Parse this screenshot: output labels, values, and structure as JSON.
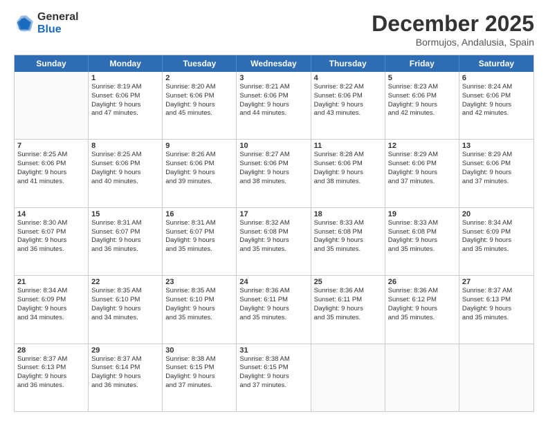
{
  "logo": {
    "general": "General",
    "blue": "Blue"
  },
  "header": {
    "month": "December 2025",
    "location": "Bormujos, Andalusia, Spain"
  },
  "weekdays": [
    "Sunday",
    "Monday",
    "Tuesday",
    "Wednesday",
    "Thursday",
    "Friday",
    "Saturday"
  ],
  "rows": [
    [
      {
        "day": "",
        "lines": []
      },
      {
        "day": "1",
        "lines": [
          "Sunrise: 8:19 AM",
          "Sunset: 6:06 PM",
          "Daylight: 9 hours",
          "and 47 minutes."
        ]
      },
      {
        "day": "2",
        "lines": [
          "Sunrise: 8:20 AM",
          "Sunset: 6:06 PM",
          "Daylight: 9 hours",
          "and 45 minutes."
        ]
      },
      {
        "day": "3",
        "lines": [
          "Sunrise: 8:21 AM",
          "Sunset: 6:06 PM",
          "Daylight: 9 hours",
          "and 44 minutes."
        ]
      },
      {
        "day": "4",
        "lines": [
          "Sunrise: 8:22 AM",
          "Sunset: 6:06 PM",
          "Daylight: 9 hours",
          "and 43 minutes."
        ]
      },
      {
        "day": "5",
        "lines": [
          "Sunrise: 8:23 AM",
          "Sunset: 6:06 PM",
          "Daylight: 9 hours",
          "and 42 minutes."
        ]
      },
      {
        "day": "6",
        "lines": [
          "Sunrise: 8:24 AM",
          "Sunset: 6:06 PM",
          "Daylight: 9 hours",
          "and 42 minutes."
        ]
      }
    ],
    [
      {
        "day": "7",
        "lines": [
          "Sunrise: 8:25 AM",
          "Sunset: 6:06 PM",
          "Daylight: 9 hours",
          "and 41 minutes."
        ]
      },
      {
        "day": "8",
        "lines": [
          "Sunrise: 8:25 AM",
          "Sunset: 6:06 PM",
          "Daylight: 9 hours",
          "and 40 minutes."
        ]
      },
      {
        "day": "9",
        "lines": [
          "Sunrise: 8:26 AM",
          "Sunset: 6:06 PM",
          "Daylight: 9 hours",
          "and 39 minutes."
        ]
      },
      {
        "day": "10",
        "lines": [
          "Sunrise: 8:27 AM",
          "Sunset: 6:06 PM",
          "Daylight: 9 hours",
          "and 38 minutes."
        ]
      },
      {
        "day": "11",
        "lines": [
          "Sunrise: 8:28 AM",
          "Sunset: 6:06 PM",
          "Daylight: 9 hours",
          "and 38 minutes."
        ]
      },
      {
        "day": "12",
        "lines": [
          "Sunrise: 8:29 AM",
          "Sunset: 6:06 PM",
          "Daylight: 9 hours",
          "and 37 minutes."
        ]
      },
      {
        "day": "13",
        "lines": [
          "Sunrise: 8:29 AM",
          "Sunset: 6:06 PM",
          "Daylight: 9 hours",
          "and 37 minutes."
        ]
      }
    ],
    [
      {
        "day": "14",
        "lines": [
          "Sunrise: 8:30 AM",
          "Sunset: 6:07 PM",
          "Daylight: 9 hours",
          "and 36 minutes."
        ]
      },
      {
        "day": "15",
        "lines": [
          "Sunrise: 8:31 AM",
          "Sunset: 6:07 PM",
          "Daylight: 9 hours",
          "and 36 minutes."
        ]
      },
      {
        "day": "16",
        "lines": [
          "Sunrise: 8:31 AM",
          "Sunset: 6:07 PM",
          "Daylight: 9 hours",
          "and 35 minutes."
        ]
      },
      {
        "day": "17",
        "lines": [
          "Sunrise: 8:32 AM",
          "Sunset: 6:08 PM",
          "Daylight: 9 hours",
          "and 35 minutes."
        ]
      },
      {
        "day": "18",
        "lines": [
          "Sunrise: 8:33 AM",
          "Sunset: 6:08 PM",
          "Daylight: 9 hours",
          "and 35 minutes."
        ]
      },
      {
        "day": "19",
        "lines": [
          "Sunrise: 8:33 AM",
          "Sunset: 6:08 PM",
          "Daylight: 9 hours",
          "and 35 minutes."
        ]
      },
      {
        "day": "20",
        "lines": [
          "Sunrise: 8:34 AM",
          "Sunset: 6:09 PM",
          "Daylight: 9 hours",
          "and 35 minutes."
        ]
      }
    ],
    [
      {
        "day": "21",
        "lines": [
          "Sunrise: 8:34 AM",
          "Sunset: 6:09 PM",
          "Daylight: 9 hours",
          "and 34 minutes."
        ]
      },
      {
        "day": "22",
        "lines": [
          "Sunrise: 8:35 AM",
          "Sunset: 6:10 PM",
          "Daylight: 9 hours",
          "and 34 minutes."
        ]
      },
      {
        "day": "23",
        "lines": [
          "Sunrise: 8:35 AM",
          "Sunset: 6:10 PM",
          "Daylight: 9 hours",
          "and 35 minutes."
        ]
      },
      {
        "day": "24",
        "lines": [
          "Sunrise: 8:36 AM",
          "Sunset: 6:11 PM",
          "Daylight: 9 hours",
          "and 35 minutes."
        ]
      },
      {
        "day": "25",
        "lines": [
          "Sunrise: 8:36 AM",
          "Sunset: 6:11 PM",
          "Daylight: 9 hours",
          "and 35 minutes."
        ]
      },
      {
        "day": "26",
        "lines": [
          "Sunrise: 8:36 AM",
          "Sunset: 6:12 PM",
          "Daylight: 9 hours",
          "and 35 minutes."
        ]
      },
      {
        "day": "27",
        "lines": [
          "Sunrise: 8:37 AM",
          "Sunset: 6:13 PM",
          "Daylight: 9 hours",
          "and 35 minutes."
        ]
      }
    ],
    [
      {
        "day": "28",
        "lines": [
          "Sunrise: 8:37 AM",
          "Sunset: 6:13 PM",
          "Daylight: 9 hours",
          "and 36 minutes."
        ]
      },
      {
        "day": "29",
        "lines": [
          "Sunrise: 8:37 AM",
          "Sunset: 6:14 PM",
          "Daylight: 9 hours",
          "and 36 minutes."
        ]
      },
      {
        "day": "30",
        "lines": [
          "Sunrise: 8:38 AM",
          "Sunset: 6:15 PM",
          "Daylight: 9 hours",
          "and 37 minutes."
        ]
      },
      {
        "day": "31",
        "lines": [
          "Sunrise: 8:38 AM",
          "Sunset: 6:15 PM",
          "Daylight: 9 hours",
          "and 37 minutes."
        ]
      },
      {
        "day": "",
        "lines": []
      },
      {
        "day": "",
        "lines": []
      },
      {
        "day": "",
        "lines": []
      }
    ]
  ]
}
